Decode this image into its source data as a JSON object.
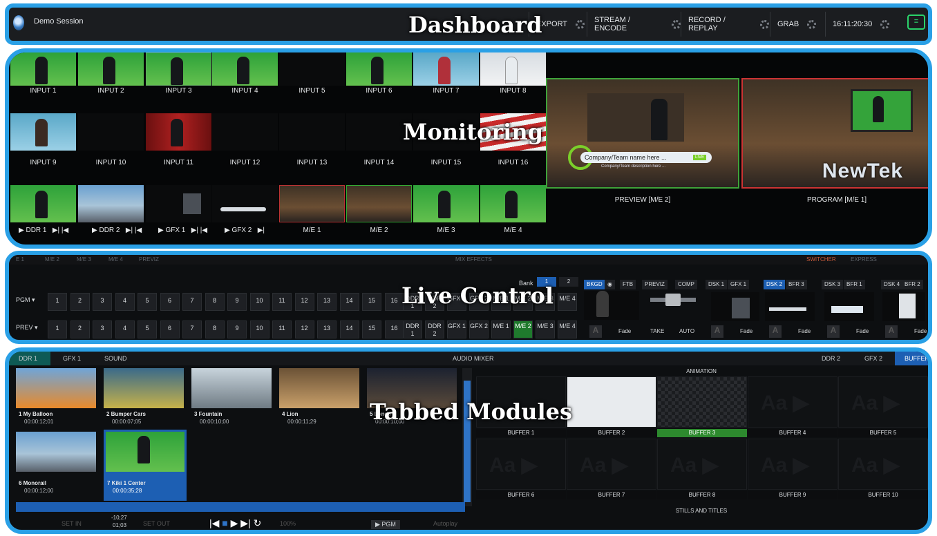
{
  "overlays": {
    "dashboard": "Dashboard",
    "monitoring": "Monitoring",
    "live": "Live Control",
    "tabbed": "Tabbed Modules"
  },
  "dashboard": {
    "session": "Demo Session",
    "buttons": [
      "EXPORT",
      "STREAM / ENCODE",
      "RECORD / REPLAY",
      "GRAB"
    ],
    "clock": "16:11:20:30"
  },
  "monitoring": {
    "row1": [
      "INPUT 1",
      "INPUT 2",
      "INPUT 3",
      "INPUT 4",
      "INPUT 5",
      "INPUT 6",
      "INPUT 7",
      "INPUT 8"
    ],
    "row2": [
      "INPUT 9",
      "INPUT 10",
      "INPUT 11",
      "INPUT 12",
      "INPUT 13",
      "INPUT 14",
      "INPUT 15",
      "INPUT 16"
    ],
    "row3": [
      "DDR 1",
      "DDR 2",
      "GFX 1",
      "GFX 2",
      "M/E 1",
      "M/E 2",
      "M/E 3",
      "M/E 4"
    ],
    "preview_label": "PREVIEW [M/E 2]",
    "program_label": "PROGRAM [M/E 1]",
    "lower_third": "Company/Team name here ...",
    "lower_third_sub": "Company/Team description here ...",
    "live_badge": "LIVE",
    "brand": "NewTek"
  },
  "live": {
    "tabs": [
      "E 1",
      "M/E 2",
      "M/E 3",
      "M/E 4",
      "PREVIZ",
      "MIX EFFECTS",
      "SWITCHER",
      "EXPRESS"
    ],
    "bank_label": "Bank",
    "banks": [
      "1",
      "2"
    ],
    "pgm_label": "PGM ▾",
    "prev_label": "PREV ▾",
    "numbers": [
      "1",
      "2",
      "3",
      "4",
      "5",
      "6",
      "7",
      "8",
      "9",
      "10",
      "11",
      "12",
      "13",
      "14",
      "15",
      "16"
    ],
    "extra": [
      "DDR 1",
      "DDR 2",
      "GFX 1",
      "GFX 2",
      "M/E 1",
      "M/E 2",
      "M/E 3",
      "M/E 4"
    ],
    "bkgd": "BKGD",
    "ftb": "FTB",
    "previz": "PREVIZ",
    "comp": "COMP",
    "take": "TAKE",
    "auto": "AUTO",
    "fade": "Fade",
    "dsk": [
      {
        "name": "DSK 1",
        "src": "GFX 1"
      },
      {
        "name": "DSK 2",
        "src": "BFR 3"
      },
      {
        "name": "DSK 3",
        "src": "BFR 1"
      },
      {
        "name": "DSK 4",
        "src": "BFR 2"
      }
    ]
  },
  "modules": {
    "tabs_left": [
      "DDR 1",
      "GFX 1",
      "SOUND"
    ],
    "center_tab": "AUDIO MIXER",
    "tabs_right": [
      "DDR 2",
      "GFX 2",
      "BUFFERS"
    ],
    "clips": [
      {
        "name": "1  My Balloon",
        "time": "00:00:12;01"
      },
      {
        "name": "2  Bumper Cars",
        "time": "00:00:07;05"
      },
      {
        "name": "3  Fountain",
        "time": "00:00:10;00"
      },
      {
        "name": "4  Lion",
        "time": "00:00:11;29"
      },
      {
        "name": "5  Londo",
        "time": "00:00:10;00"
      },
      {
        "name": "6  Monorail",
        "time": "00:00:12;00"
      },
      {
        "name": "7  Kiki 1 Center",
        "time": "00:00:35;28"
      }
    ],
    "set_in": "SET IN",
    "set_out": "SET OUT",
    "dur1": "-10;27",
    "dur2": "01;03",
    "speed": "100%",
    "pgm": "▶ PGM",
    "autoplay": "Autoplay",
    "animation": "ANIMATION",
    "stills": "STILLS AND TITLES",
    "buffers": [
      "BUFFER 1",
      "BUFFER 2",
      "BUFFER 3",
      "BUFFER 4",
      "BUFFER 5",
      "BUFFER 6",
      "BUFFER 7",
      "BUFFER 8",
      "BUFFER 9",
      "BUFFER 10"
    ]
  }
}
